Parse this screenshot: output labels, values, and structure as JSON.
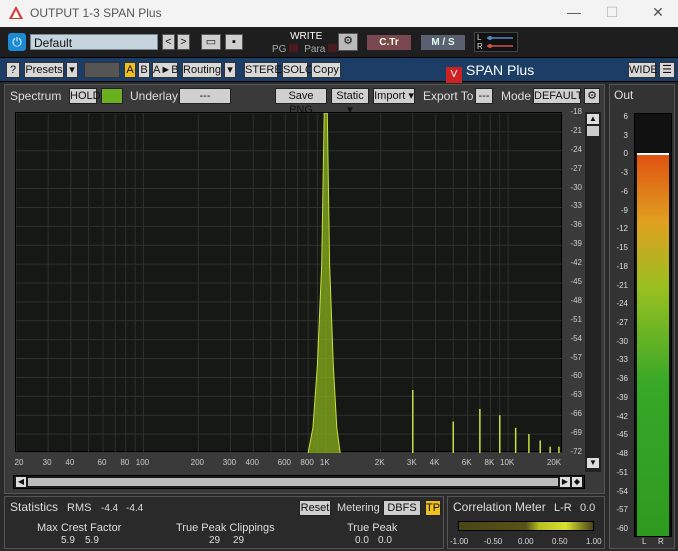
{
  "window": {
    "title": "OUTPUT 1-3 SPAN Plus",
    "minimize": "—",
    "maximize": "☐",
    "close": "✕"
  },
  "toolbar1": {
    "preset_value": "Default",
    "prev": "<",
    "next": ">",
    "write_label": "WRITE",
    "pg_label": "PG",
    "para_label": "Para",
    "ctr_label": "C.Tr",
    "ms_label": "M / S",
    "l_label": "L",
    "r_label": "R"
  },
  "toolbar2": {
    "help": "?",
    "presets": "Presets",
    "dd": "▾",
    "a": "A",
    "b": "B",
    "ab": "A►B",
    "routing": "Routing",
    "stereo": "STEREO",
    "solo": "SOLO",
    "copy": "Copy",
    "brand": "SPAN Plus",
    "brand_logo": "V",
    "wide": "WIDE",
    "menu": "☰"
  },
  "spectrum": {
    "label": "Spectrum",
    "hold": "HOLD",
    "underlay_label": "Underlay",
    "underlay_value": "---",
    "save_png": "Save PNG",
    "static": "Static ▾",
    "import": "Import ▾",
    "export_to": "Export To",
    "export_value": "---",
    "mode_label": "Mode",
    "mode_value": "DEFAULT",
    "db_ticks": [
      "-18",
      "-21",
      "-24",
      "-27",
      "-30",
      "-33",
      "-36",
      "-39",
      "-42",
      "-45",
      "-48",
      "-51",
      "-54",
      "-57",
      "-60",
      "-63",
      "-66",
      "-69",
      "-72"
    ],
    "freq_ticks": [
      "20",
      "30",
      "40",
      "60",
      "80",
      "100",
      "200",
      "300",
      "400",
      "600",
      "800",
      "1K",
      "2K",
      "3K",
      "4K",
      "6K",
      "8K",
      "10K",
      "20K"
    ]
  },
  "chart_data": {
    "type": "line",
    "xlabel": "",
    "ylabel": "",
    "x_scale": "log",
    "xlim": [
      20,
      20000
    ],
    "ylim": [
      -72,
      -18
    ],
    "series": [
      {
        "x": [
          800,
          850,
          900,
          950,
          980,
          1000,
          1020,
          1050,
          1100,
          1150,
          1200
        ],
        "values": [
          -72,
          -68,
          -58,
          -42,
          -18,
          -18,
          -18,
          -42,
          -58,
          -68,
          -72
        ]
      }
    ],
    "harmonics": [
      {
        "x": 3000,
        "y": -62
      },
      {
        "x": 5000,
        "y": -67
      },
      {
        "x": 7000,
        "y": -65
      },
      {
        "x": 9000,
        "y": -66
      },
      {
        "x": 11000,
        "y": -68
      },
      {
        "x": 13000,
        "y": -69
      },
      {
        "x": 15000,
        "y": -70
      },
      {
        "x": 17000,
        "y": -71
      },
      {
        "x": 19000,
        "y": -71
      }
    ],
    "colors": {
      "fill": "#8ab01c",
      "line": "#c8e040"
    }
  },
  "output": {
    "label": "Out",
    "scale": [
      "6",
      "3",
      "0",
      "-3",
      "-6",
      "-9",
      "-12",
      "-15",
      "-18",
      "-21",
      "-24",
      "-27",
      "-30",
      "-33",
      "-36",
      "-39",
      "-42",
      "-45",
      "-48",
      "-51",
      "-54",
      "-57",
      "-60"
    ],
    "l": "L",
    "r": "R",
    "level_db": 0
  },
  "statistics": {
    "label": "Statistics",
    "rms_label": "RMS",
    "rms_l": "-4.4",
    "rms_r": "-4.4",
    "reset": "Reset",
    "metering_label": "Metering",
    "metering_value": "DBFS",
    "tp": "TP",
    "crest_label": "Max Crest Factor",
    "crest_l": "5.9",
    "crest_r": "5.9",
    "clip_label": "True Peak Clippings",
    "clip_l": "29",
    "clip_r": "29",
    "tp_label": "True Peak",
    "tp_l": "0.0",
    "tp_r": "0.0"
  },
  "correlation": {
    "label": "Correlation Meter",
    "lr": "L-R",
    "value": "0.0",
    "ticks": [
      "-1.00",
      "-0.50",
      "0.00",
      "0.50",
      "1.00"
    ]
  }
}
